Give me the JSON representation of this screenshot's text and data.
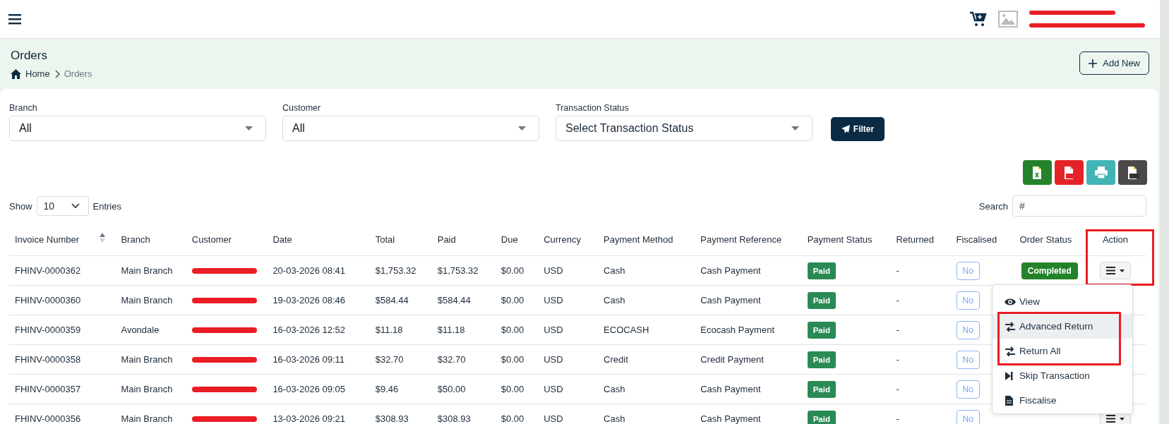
{
  "header": {
    "user_redacted": true
  },
  "page": {
    "title": "Orders",
    "breadcrumb": [
      {
        "label": "Home",
        "current": false
      },
      {
        "label": "Orders",
        "current": true
      }
    ],
    "add_button": "Add New"
  },
  "filters": [
    {
      "label": "Branch",
      "value": "All",
      "placeholder": false
    },
    {
      "label": "Customer",
      "value": "All",
      "placeholder": false
    },
    {
      "label": "Transaction Status",
      "value": "Select Transaction Status",
      "placeholder": true
    }
  ],
  "filter_button": "Filter",
  "exports": [
    {
      "kind": "excel",
      "color": "#23822a"
    },
    {
      "kind": "pdf",
      "color": "#e32327"
    },
    {
      "kind": "print",
      "color": "#42b4b6"
    },
    {
      "kind": "csv",
      "color": "#4b4a49"
    }
  ],
  "length": {
    "label_before": "Show",
    "value": "10",
    "label_after": "Entries"
  },
  "search": {
    "label": "Search",
    "value": "#"
  },
  "table": {
    "columns": [
      {
        "label": "Invoice Number",
        "sorted_ascending": true
      },
      {
        "label": "Branch"
      },
      {
        "label": "Customer"
      },
      {
        "label": "Date"
      },
      {
        "label": "Total"
      },
      {
        "label": "Paid"
      },
      {
        "label": "Due"
      },
      {
        "label": "Currency"
      },
      {
        "label": "Payment Method"
      },
      {
        "label": "Payment Reference"
      },
      {
        "label": "Payment Status"
      },
      {
        "label": "Returned"
      },
      {
        "label": "Fiscalised"
      },
      {
        "label": "Order Status"
      },
      {
        "label": "Action",
        "highlighted": true
      }
    ],
    "rows": [
      {
        "invoice": "FHINV-0000362",
        "branch": "Main Branch",
        "customer_redacted": true,
        "date": "20-03-2026 08:41",
        "total": "$1,753.32",
        "paid": "$1,753.32",
        "due": "$0.00",
        "currency": "USD",
        "method": "Cash",
        "reference": "Cash Payment",
        "payment_status": "Paid",
        "returned": "-",
        "fiscalised": "No",
        "order_status": "Completed",
        "action": true
      },
      {
        "invoice": "FHINV-0000360",
        "branch": "Main Branch",
        "customer_redacted": true,
        "date": "19-03-2026 08:46",
        "total": "$584.44",
        "paid": "$584.44",
        "due": "$0.00",
        "currency": "USD",
        "method": "Cash",
        "reference": "Cash Payment",
        "payment_status": "Paid",
        "returned": "-",
        "fiscalised": "No"
      },
      {
        "invoice": "FHINV-0000359",
        "branch": "Avondale",
        "customer_redacted": true,
        "date": "16-03-2026 12:52",
        "total": "$11.18",
        "paid": "$11.18",
        "due": "$0.00",
        "currency": "USD",
        "method": "ECOCASH",
        "reference": "Ecocash Payment",
        "payment_status": "Paid",
        "returned": "-",
        "fiscalised": "No"
      },
      {
        "invoice": "FHINV-0000358",
        "branch": "Main Branch",
        "customer_redacted": true,
        "date": "16-03-2026 09:11",
        "total": "$32.70",
        "paid": "$32.70",
        "due": "$0.00",
        "currency": "USD",
        "method": "Credit",
        "reference": "Credit Payment",
        "payment_status": "Paid",
        "returned": "-",
        "fiscalised": "No"
      },
      {
        "invoice": "FHINV-0000357",
        "branch": "Main Branch",
        "customer_redacted": true,
        "date": "16-03-2026 09:05",
        "total": "$9.46",
        "paid": "$50.00",
        "due": "$0.00",
        "currency": "USD",
        "method": "Cash",
        "reference": "Cash Payment",
        "payment_status": "Paid",
        "returned": "-",
        "fiscalised": "No"
      },
      {
        "invoice": "FHINV-0000356",
        "branch": "Main Branch",
        "customer_redacted": true,
        "date": "13-03-2026 09:21",
        "total": "$308.93",
        "paid": "$308.93",
        "due": "$0.00",
        "currency": "USD",
        "method": "Cash",
        "reference": "Cash Payment",
        "payment_status": "Paid",
        "returned": "-",
        "fiscalised": "No",
        "action": true
      }
    ]
  },
  "action_menu": {
    "items": [
      {
        "kind": "view",
        "label": "View",
        "highlighted": false
      },
      {
        "kind": "return",
        "label": "Advanced Return",
        "hovered": true,
        "highlighted": true
      },
      {
        "kind": "return",
        "label": "Return All",
        "highlighted": true
      },
      {
        "kind": "skip",
        "label": "Skip Transaction",
        "highlighted": false
      },
      {
        "kind": "fiscalise",
        "label": "Fiscalise",
        "highlighted": false
      }
    ]
  }
}
